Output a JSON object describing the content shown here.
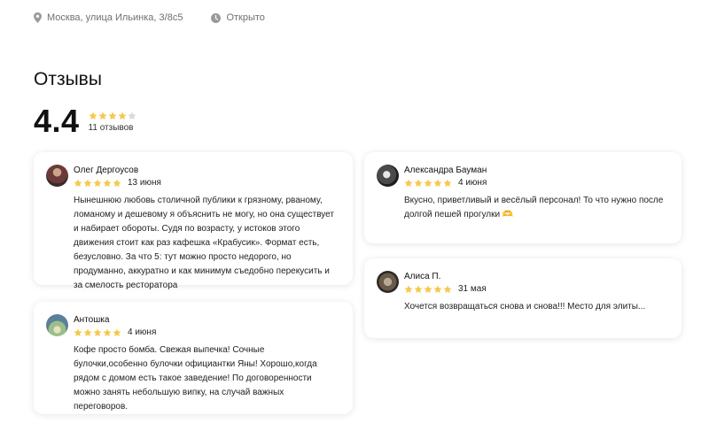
{
  "header": {
    "address": "Москва, улица Ильинка, 3/8с5",
    "address_icon": "location-pin-icon",
    "status": "Открыто",
    "status_icon": "clock-icon"
  },
  "reviews_section": {
    "title": "Отзывы",
    "rating": "4.4",
    "rating_value": 4.4,
    "rating_max": 5,
    "count_label": "11 отзывов"
  },
  "colors": {
    "star_filled": "#f6c84b",
    "star_empty": "#d8d8d8",
    "muted_text": "#707070"
  },
  "reviews": [
    {
      "author": "Олег Дергоусов",
      "stars": 5,
      "date": "13 июня",
      "text": "Нынешнюю любовь столичной публики к грязному, рваному, ломаному и дешевому я объяснить не могу, но она существует и набирает обороты. Судя по возрасту, у истоков этого движения стоит как раз кафешка «Крабусик». Формат есть, безусловно. За что 5: тут можно просто недорого, но продуманно, аккуратно и как минимум съедобно перекусить и за смелость ресторатора"
    },
    {
      "author": "Антошка",
      "stars": 5,
      "date": "4 июня",
      "text": "Кофе просто бомба. Свежая выпечка! Сочные булочки,особенно булочки официантки Яны! Хорошо,когда рядом с домом есть такое заведение! По договоренности можно занять небольшую випку, на случай важных переговоров."
    },
    {
      "author": "Александра Бауман",
      "stars": 5,
      "date": "4 июня",
      "text": "Вкусно, приветливый и весёлый персонал! То что нужно после долгой пешей прогулки 🫶"
    },
    {
      "author": "Алиса П.",
      "stars": 5,
      "date": "31 мая",
      "text": "Хочется возвращаться снова и снова!!! Место для элиты..."
    }
  ]
}
